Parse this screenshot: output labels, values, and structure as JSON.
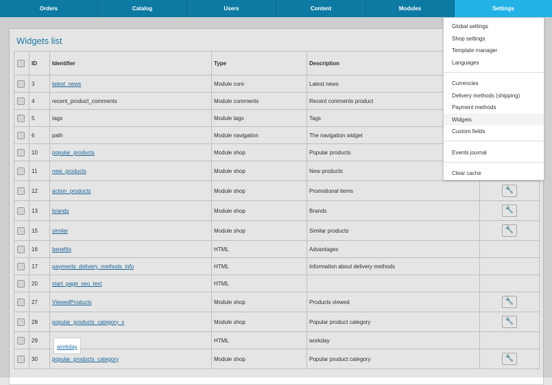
{
  "nav": {
    "tabs": [
      {
        "label": "Orders"
      },
      {
        "label": "Catalog"
      },
      {
        "label": "Users"
      },
      {
        "label": "Content"
      },
      {
        "label": "Modules"
      },
      {
        "label": "Settings"
      }
    ],
    "active_index": 5,
    "colors": {
      "bar": "#0d7aa3",
      "active": "#22b2e6"
    }
  },
  "page": {
    "title": "Widgets list"
  },
  "table": {
    "headers": {
      "id": "ID",
      "identifier": "Identifier",
      "type": "Type",
      "description": "Description"
    },
    "rows": [
      {
        "id": "3",
        "identifier": "latest_news",
        "type": "Module core",
        "description": "Latest news"
      },
      {
        "id": "4",
        "identifier": "recent_product_comments",
        "type": "Module comments",
        "description": "Recent comments product"
      },
      {
        "id": "5",
        "identifier": "tags",
        "type": "Module tags",
        "description": "Tags"
      },
      {
        "id": "6",
        "identifier": "path",
        "type": "Module navigation",
        "description": "The navigation widget"
      },
      {
        "id": "10",
        "identifier": "popular_products",
        "type": "Module shop",
        "description": "Popular products"
      },
      {
        "id": "11",
        "identifier": "new_products",
        "type": "Module shop",
        "description": "New products"
      },
      {
        "id": "12",
        "identifier": "action_products",
        "type": "Module shop",
        "description": "Promotional items"
      },
      {
        "id": "13",
        "identifier": "brands",
        "type": "Module shop",
        "description": "Brands"
      },
      {
        "id": "15",
        "identifier": "similar",
        "type": "Module shop",
        "description": "Similar products"
      },
      {
        "id": "16",
        "identifier": "benefits",
        "type": "HTML",
        "description": "Advantages"
      },
      {
        "id": "17",
        "identifier": "payments_delivery_methods_info",
        "type": "HTML",
        "description": "Information about delivery methods"
      },
      {
        "id": "20",
        "identifier": "start_page_seo_text",
        "type": "HTML",
        "description": ""
      },
      {
        "id": "27",
        "identifier": "ViewedProducts",
        "type": "Module shop",
        "description": "Products viewed"
      },
      {
        "id": "28",
        "identifier": "popular_products_category_v",
        "type": "Module shop",
        "description": "Popular product category"
      },
      {
        "id": "29",
        "identifier": "workday",
        "type": "HTML",
        "description": "workday"
      },
      {
        "id": "30",
        "identifier": "popular_products_category",
        "type": "Module shop",
        "description": "Popular product category"
      }
    ]
  },
  "settings_menu": {
    "items": [
      {
        "label": "Global settings"
      },
      {
        "label": "Shop settings"
      },
      {
        "label": "Template manager"
      },
      {
        "label": "Languages"
      },
      {
        "label": "Currencies"
      },
      {
        "label": "Delivery methods (shipping)"
      },
      {
        "label": "Payment methods"
      },
      {
        "label": "Widgets"
      },
      {
        "label": "Custom fields"
      },
      {
        "label": "Events journal"
      },
      {
        "label": "Clear cache"
      }
    ],
    "active_label": "Widgets"
  },
  "icons": {
    "checkbox": "checkbox-icon",
    "settings": "wrench-icon"
  }
}
